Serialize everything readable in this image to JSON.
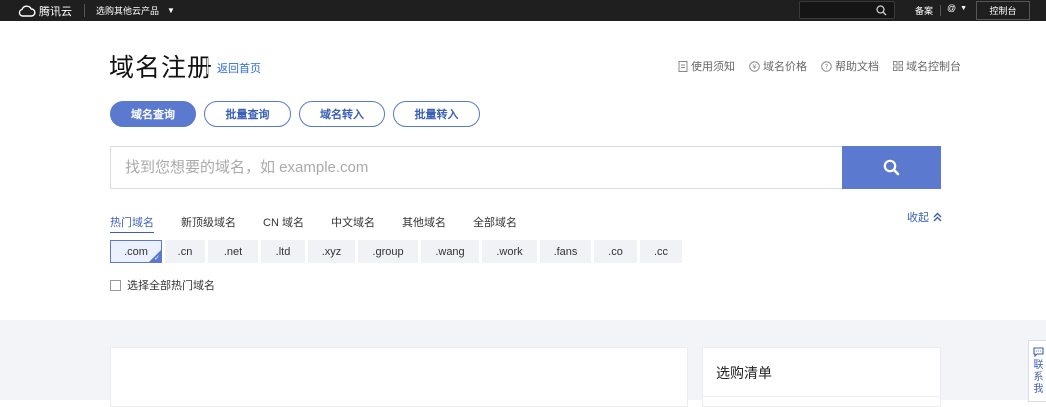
{
  "topbar": {
    "logo_text": "腾讯云",
    "products_label": "选购其他云产品",
    "beian_label": "备案",
    "account_label": "@",
    "console_label": "控制台"
  },
  "header": {
    "title": "域名注册",
    "back_home": "返回首页",
    "links": [
      {
        "label": "使用须知",
        "icon": "document-icon"
      },
      {
        "label": "域名价格",
        "icon": "price-icon"
      },
      {
        "label": "帮助文档",
        "icon": "help-icon"
      },
      {
        "label": "域名控制台",
        "icon": "grid-icon"
      }
    ]
  },
  "tabs": [
    {
      "label": "域名查询",
      "active": true
    },
    {
      "label": "批量查询",
      "active": false
    },
    {
      "label": "域名转入",
      "active": false
    },
    {
      "label": "批量转入",
      "active": false
    }
  ],
  "search": {
    "placeholder": "找到您想要的域名，如 example.com",
    "value": ""
  },
  "category_tabs": [
    {
      "label": "热门域名",
      "active": true
    },
    {
      "label": "新顶级域名",
      "active": false
    },
    {
      "label": "CN 域名",
      "active": false
    },
    {
      "label": "中文域名",
      "active": false
    },
    {
      "label": "其他域名",
      "active": false
    },
    {
      "label": "全部域名",
      "active": false
    }
  ],
  "collapse_label": "收起",
  "suffixes": [
    {
      "label": ".com",
      "selected": true
    },
    {
      "label": ".cn",
      "selected": false
    },
    {
      "label": ".net",
      "selected": false
    },
    {
      "label": ".ltd",
      "selected": false
    },
    {
      "label": ".xyz",
      "selected": false
    },
    {
      "label": ".group",
      "selected": false
    },
    {
      "label": ".wang",
      "selected": false
    },
    {
      "label": ".work",
      "selected": false
    },
    {
      "label": ".fans",
      "selected": false
    },
    {
      "label": ".co",
      "selected": false
    },
    {
      "label": ".cc",
      "selected": false
    }
  ],
  "select_all_label": "选择全部热门域名",
  "cart": {
    "title": "选购清单"
  },
  "side_widget": {
    "chars": [
      "联",
      "系",
      "我"
    ]
  },
  "colors": {
    "accent": "#5b79cf",
    "link": "#2b6ae0",
    "topbar": "#1f1f1f"
  }
}
